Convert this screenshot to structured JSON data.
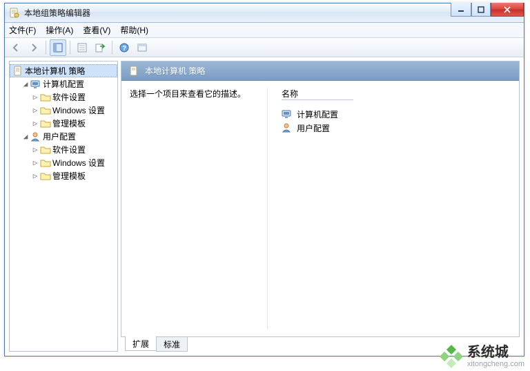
{
  "window": {
    "title": "本地组策略编辑器"
  },
  "menu": {
    "file": "文件(F)",
    "action": "操作(A)",
    "view": "查看(V)",
    "help": "帮助(H)"
  },
  "tree": {
    "root": "本地计算机 策略",
    "computer": "计算机配置",
    "c_soft": "软件设置",
    "c_win": "Windows 设置",
    "c_admin": "管理模板",
    "user": "用户配置",
    "u_soft": "软件设置",
    "u_win": "Windows 设置",
    "u_admin": "管理模板"
  },
  "content": {
    "header": "本地计算机 策略",
    "hint": "选择一个项目来查看它的描述。",
    "name_col": "名称",
    "items": {
      "computer": "计算机配置",
      "user": "用户配置"
    }
  },
  "tabs": {
    "extended": "扩展",
    "standard": "标准"
  },
  "watermark": {
    "brand": "系统城",
    "url": "xitongcheng.com"
  }
}
